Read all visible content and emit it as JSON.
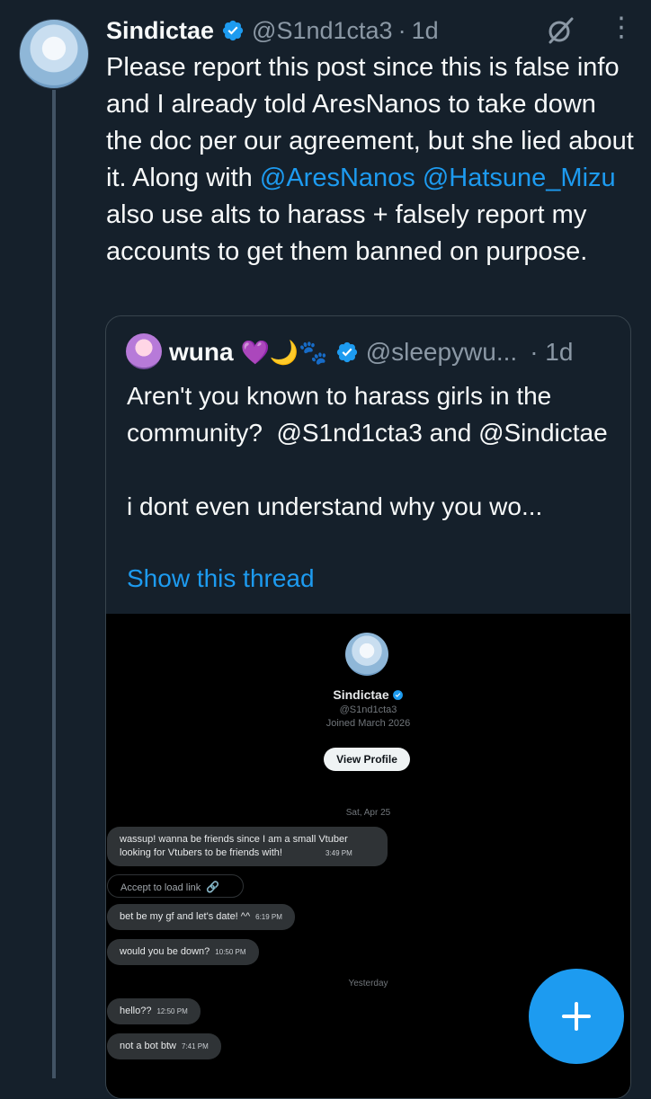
{
  "tweet": {
    "name": "Sindictae",
    "handle": "@S1nd1cta3",
    "separator": "·",
    "time": "1d",
    "text_part1": "Please report this post since this is false info and I already told AresNanos to take down the doc per our agreement, but she lied about it. Along with ",
    "mention1": "@AresNanos",
    "mention2": "@Hatsune_Mizu",
    "text_part2": " also use alts to harass + falsely report my accounts to get them banned on purpose."
  },
  "quote": {
    "name": "wuna",
    "emojis": "💜🌙🐾",
    "handle": "@sleepywu...",
    "time": "· 1d",
    "text": "Aren't you known to harass girls in the community?  @S1nd1cta3 and @Sindictae\n\ni dont even understand why you wo...",
    "show_thread": "Show this thread"
  },
  "dm": {
    "name": "Sindictae",
    "handle": "@S1nd1cta3",
    "joined": "Joined March 2026",
    "view_profile": "View Profile",
    "date1": "Sat, Apr 25",
    "messages": [
      {
        "text_line1": "wassup! wanna be friends since I am a small Vtuber",
        "text_line2": "looking for Vtubers to be friends with!",
        "time": "3:49 PM"
      },
      {
        "text": "bet be my gf and let's date! ^^",
        "time": "6:19 PM"
      },
      {
        "text": "would you be down?",
        "time": "10:50 PM"
      },
      {
        "text": "hello??",
        "time": "12:50 PM"
      },
      {
        "text": "not a bot btw",
        "time": "7:41 PM"
      }
    ],
    "link_chip": "Accept to load link",
    "date2": "Yesterday"
  },
  "colors": {
    "background": "#15202b",
    "accent": "#1d9bf0",
    "secondary_text": "#8b98a5"
  }
}
